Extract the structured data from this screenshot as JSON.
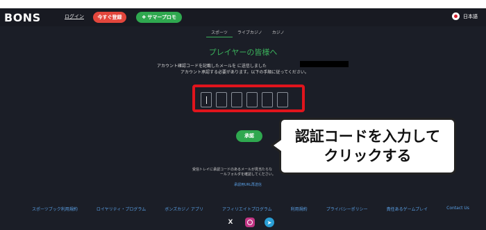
{
  "header": {
    "logo": "BONS",
    "login_label": "ログイン",
    "register_label": "今すぐ登録",
    "promo_label": "サマープロモ",
    "language": "日本語"
  },
  "tabs": [
    {
      "label": "スポーツ",
      "active": true
    },
    {
      "label": "ライブカジノ",
      "active": false
    },
    {
      "label": "カジノ",
      "active": false
    }
  ],
  "main": {
    "title": "プレイヤーの皆様へ",
    "description_line1": "アカウント確認コードを記載したメールを に送信しました",
    "description_line2": "アカウント承認する必要があります。以下の手順に従ってください。",
    "code_slots": 6,
    "approve_label": "承認",
    "inbox_note_line1": "受信トレイに承認コードのあるメールが見当たらな",
    "inbox_note_line2": "ールフォルダを確認してください。",
    "resend_link": "承認用URL再送信"
  },
  "callout": {
    "line1": "認証コードを入力して",
    "line2": "クリックする"
  },
  "footer": {
    "links": [
      "スポーツブック利用規約",
      "ロイヤリティ・プログラム",
      "ボンズカジノ アプリ",
      "アフィリエイトプログラム",
      "利用規約",
      "プライバシーポリシー",
      "責任あるゲームプレイ",
      "Contact Us"
    ],
    "socials": [
      "x-icon",
      "instagram-icon",
      "telegram-icon"
    ]
  },
  "colors": {
    "background": "#1b1e27",
    "accent_green": "#2fa84f",
    "register_red": "#e3463c",
    "highlight_red": "#e0141c",
    "link_blue": "#5aa0e6"
  }
}
